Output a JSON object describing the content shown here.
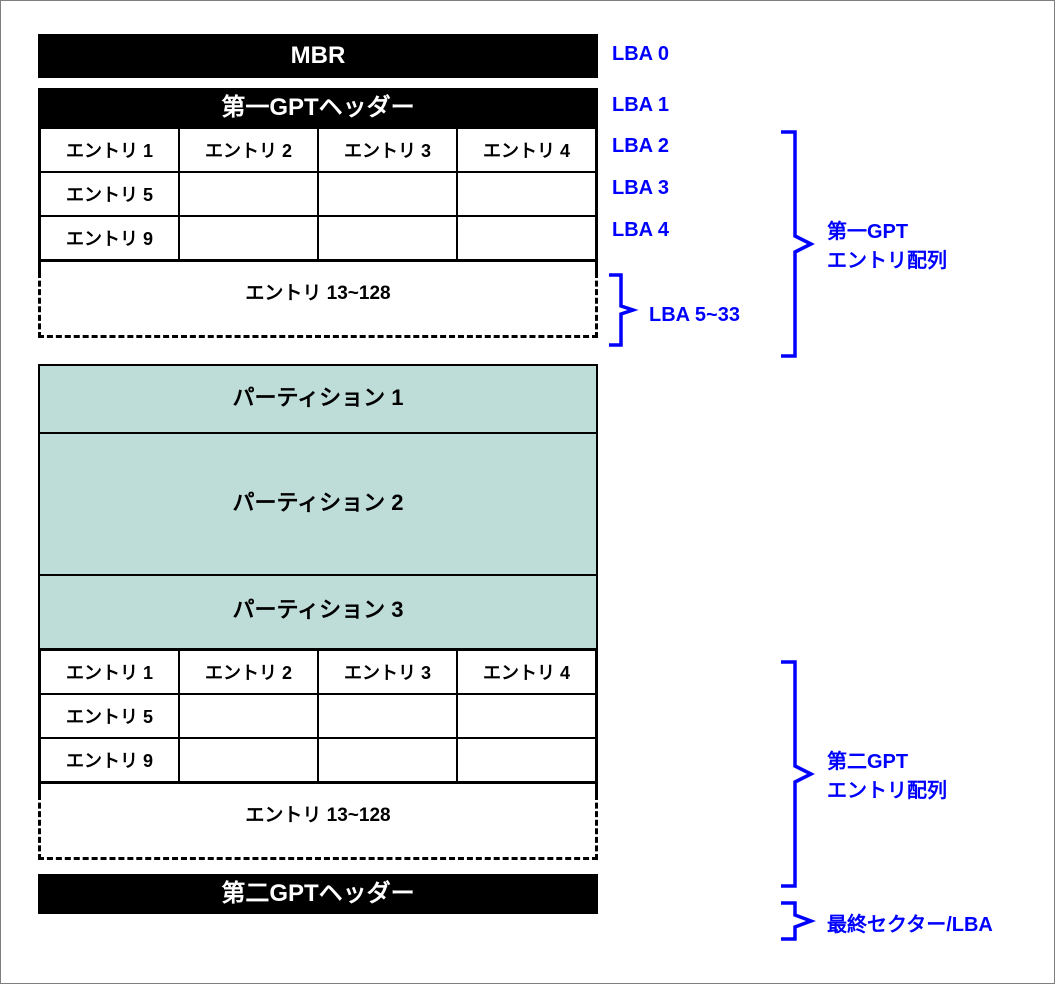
{
  "headers": {
    "mbr": "MBR",
    "gpt1": "第一GPTヘッダー",
    "gpt2": "第二GPTヘッダー"
  },
  "entries1": {
    "r1": [
      "エントリ 1",
      "エントリ 2",
      "エントリ 3",
      "エントリ 4"
    ],
    "r2": [
      "エントリ 5",
      "",
      "",
      ""
    ],
    "r3": [
      "エントリ 9",
      "",
      "",
      ""
    ],
    "rest": "エントリ 13~128"
  },
  "partitions": {
    "p1": "パーティション 1",
    "p2": "パーティション 2",
    "p3": "パーティション 3"
  },
  "entries2": {
    "r1": [
      "エントリ 1",
      "エントリ 2",
      "エントリ 3",
      "エントリ 4"
    ],
    "r2": [
      "エントリ 5",
      "",
      "",
      ""
    ],
    "r3": [
      "エントリ 9",
      "",
      "",
      ""
    ],
    "rest": "エントリ 13~128"
  },
  "lba": {
    "l0": "LBA 0",
    "l1": "LBA 1",
    "l2": "LBA 2",
    "l3": "LBA 3",
    "l4": "LBA 4",
    "l5_33": "LBA 5~33"
  },
  "annot": {
    "primary": "第一GPT\nエントリ配列",
    "secondary": "第二GPT\nエントリ配列",
    "last": "最終セクター/LBA"
  }
}
